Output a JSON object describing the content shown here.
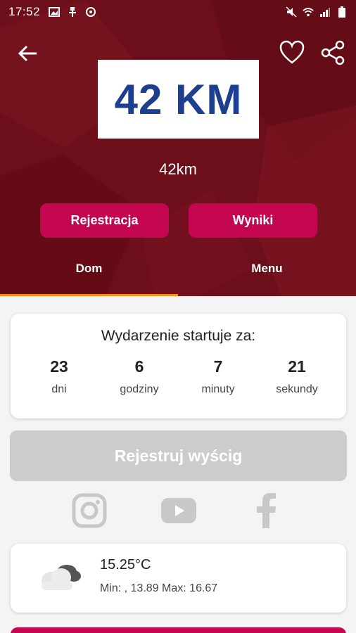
{
  "status": {
    "time": "17:52"
  },
  "header": {
    "logo_text": "42 KM",
    "event_name": "42km",
    "register_label": "Rejestracja",
    "results_label": "Wyniki"
  },
  "tabs": [
    {
      "label": "Dom",
      "active": true
    },
    {
      "label": "Menu",
      "active": false
    }
  ],
  "countdown": {
    "title": "Wydarzenie startuje za:",
    "units": [
      {
        "value": "23",
        "label": "dni"
      },
      {
        "value": "6",
        "label": "godziny"
      },
      {
        "value": "7",
        "label": "minuty"
      },
      {
        "value": "21",
        "label": "sekundy"
      }
    ]
  },
  "register_race_label": "Rejestruj wyścig",
  "social": [
    "instagram-icon",
    "youtube-icon",
    "facebook-icon"
  ],
  "weather": {
    "temperature": "15.25°C",
    "minmax": "Min: , 13.89 Max: 16.67"
  },
  "colors": {
    "header_bg": "#6d0f1a",
    "accent": "#c4054f",
    "tab_indicator": "#ff8c1a",
    "logo_text": "#1c3f8f",
    "disabled_button": "#cccccc"
  }
}
